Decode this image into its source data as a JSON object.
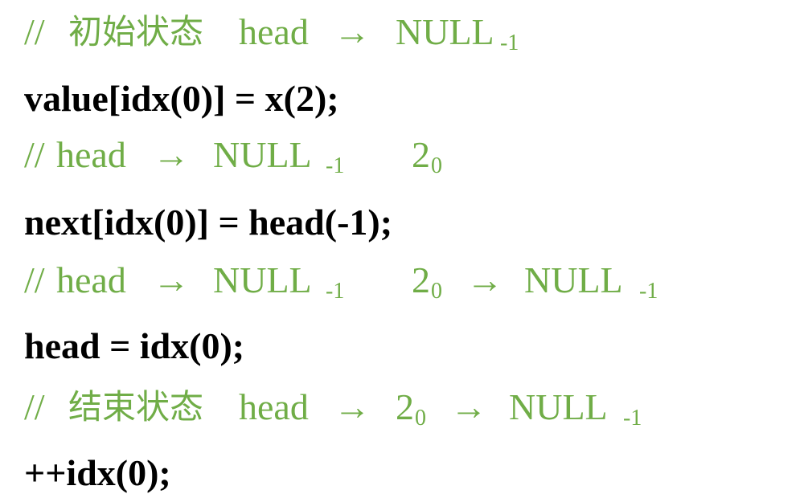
{
  "colors": {
    "comment": "#70AD47",
    "code": "#000000"
  },
  "lines": [
    {
      "type": "comment",
      "slashes": "//",
      "label": "初始状态",
      "head": "head",
      "arrow1": "→",
      "null": "NULL",
      "null_sub": "-1"
    },
    {
      "type": "code",
      "text": "value[idx(0)] = x(2);"
    },
    {
      "type": "comment",
      "slashes": "//",
      "head": "head",
      "arrow1": "→",
      "null": "NULL",
      "null_sub": "-1",
      "node": "2",
      "node_sub": "0"
    },
    {
      "type": "code",
      "text": "next[idx(0)] = head(-1);"
    },
    {
      "type": "comment",
      "slashes": "//",
      "head": "head",
      "arrow1": "→",
      "null": "NULL",
      "null_sub": "-1",
      "node": "2",
      "node_sub": "0",
      "arrow2": "→",
      "null2": "NULL",
      "null2_sub": "-1"
    },
    {
      "type": "code",
      "text": "head = idx(0);"
    },
    {
      "type": "comment",
      "slashes": "//",
      "label": "结束状态",
      "head": "head",
      "arrow1": "→",
      "node": "2",
      "node_sub": "0",
      "arrow2": "→",
      "null": "NULL",
      "null_sub": "-1"
    },
    {
      "type": "code",
      "text": "++idx(0);"
    }
  ]
}
